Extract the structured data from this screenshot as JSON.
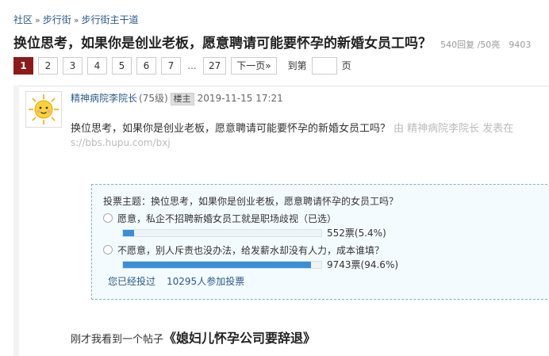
{
  "breadcrumb": {
    "items": [
      "社区",
      "步行街",
      "步行街主干道"
    ],
    "separator": "»"
  },
  "thread": {
    "title": "换位思考，如果你是创业老板，愿意聘请可能要怀孕的新婚女员工吗？",
    "stats": "540回复 /50亮",
    "views": "9403"
  },
  "pager": {
    "pages": [
      "1",
      "2",
      "3",
      "4",
      "5",
      "6",
      "7"
    ],
    "active": "1",
    "ellipsis": "...",
    "last": "27",
    "next_label": "下一页»",
    "goto_label": "到第",
    "goto_value": "",
    "page_unit": "页"
  },
  "post": {
    "author": "精神病院李院长",
    "level": "(75级)",
    "badge": "楼主",
    "time": "2019-11-15 17:21",
    "body_line1": "换位思考，如果你是创业老板，愿意聘请可能要怀孕的新婚女员工吗？",
    "watermark": "由 精神病院李院长 发表在",
    "body_line2": "s://bbs.hupu.com/bxj",
    "body_intro": "刚才我看到一个帖子",
    "body_quote": "《媳妇儿怀孕公司要辞退》"
  },
  "vote": {
    "question": "投票主题：换位思考，如果你是创业老板，愿意聘请怀孕的女员工吗？",
    "options": [
      {
        "label": "愿意，私企不招聘新婚女员工就是职场歧视（已选）",
        "count_text": "552票(5.4%)",
        "percent": 5.4
      },
      {
        "label": "不愿意，别人斥责也没办法，给发薪水却没有人力，成本谁填？",
        "count_text": "9743票(94.6%)",
        "percent": 94.6
      }
    ],
    "voted_text": "您已经投过",
    "participants": "10295人参加投票"
  },
  "colors": {
    "active_page": "#8b1a1a",
    "link": "#2a5a8a",
    "bar": "#3b8fd6",
    "vote_border": "#7fb1c8"
  }
}
